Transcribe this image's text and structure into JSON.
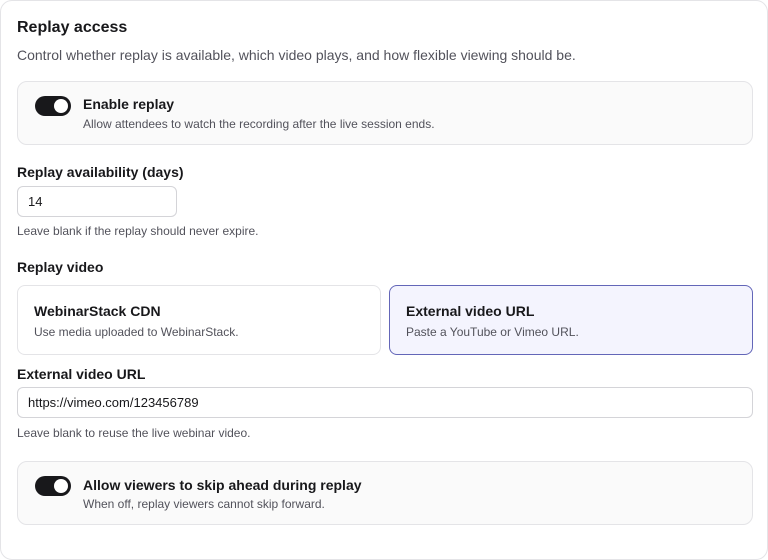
{
  "section": {
    "title": "Replay access",
    "subtitle": "Control whether replay is available, which video plays, and how flexible viewing should be."
  },
  "enable_replay": {
    "on": true,
    "title": "Enable replay",
    "description": "Allow attendees to watch the recording after the live session ends."
  },
  "availability": {
    "label": "Replay availability (days)",
    "value": "14",
    "hint": "Leave blank if the replay should never expire."
  },
  "replay_video": {
    "label": "Replay video",
    "selected": "external",
    "options": [
      {
        "id": "cdn",
        "title": "WebinarStack CDN",
        "description": "Use media uploaded to WebinarStack."
      },
      {
        "id": "external",
        "title": "External video URL",
        "description": "Paste a YouTube or Vimeo URL."
      }
    ]
  },
  "external_url": {
    "label": "External video URL",
    "value": "https://vimeo.com/123456789",
    "hint": "Leave blank to reuse the live webinar video."
  },
  "skip_ahead": {
    "on": true,
    "title": "Allow viewers to skip ahead during replay",
    "description": "When off, replay viewers cannot skip forward."
  },
  "colors": {
    "toggle_on": "#18181b",
    "selected_border": "#6366b8",
    "selected_background": "#f4f4fe"
  }
}
